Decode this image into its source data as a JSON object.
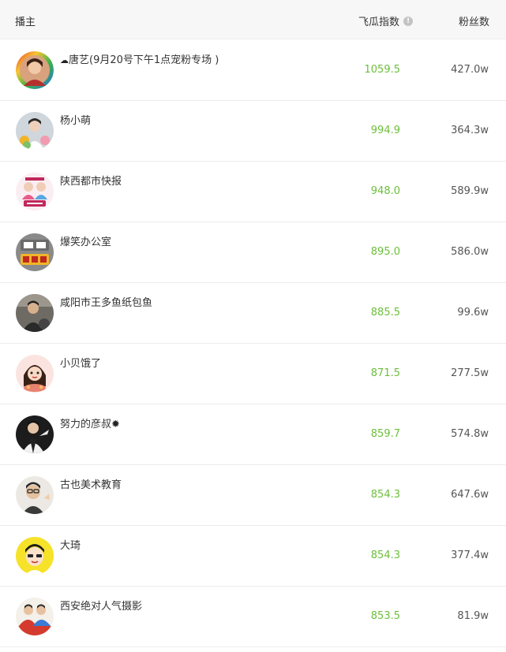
{
  "header": {
    "streamer_label": "播主",
    "index_label": "飞瓜指数",
    "fans_label": "粉丝数",
    "info_icon": "info-icon"
  },
  "rows": [
    {
      "name": "唐艺(9月20号下午1点宠粉专场 )",
      "index": "1059.5",
      "fans": "427.0w",
      "avatar": "avatar-woman-rainbow-ring"
    },
    {
      "name": "杨小萌",
      "index": "994.9",
      "fans": "364.3w",
      "avatar": "avatar-woman-flowers"
    },
    {
      "name": "陕西都市快报",
      "index": "948.0",
      "fans": "589.9w",
      "avatar": "avatar-news-logo"
    },
    {
      "name": "爆笑办公室",
      "index": "895.0",
      "fans": "586.0w",
      "avatar": "avatar-text-logo"
    },
    {
      "name": "咸阳市王多鱼纸包鱼",
      "index": "885.5",
      "fans": "99.6w",
      "avatar": "avatar-man-photo"
    },
    {
      "name": "小贝饿了",
      "index": "871.5",
      "fans": "277.5w",
      "avatar": "avatar-cartoon-girl"
    },
    {
      "name": "努力的彦叔",
      "index": "859.7",
      "fans": "574.8w",
      "avatar": "avatar-man-suit"
    },
    {
      "name": "古也美术教育",
      "index": "854.3",
      "fans": "647.6w",
      "avatar": "avatar-man-glasses"
    },
    {
      "name": "大琦",
      "index": "854.3",
      "fans": "377.4w",
      "avatar": "avatar-cartoon-boy-yellow"
    },
    {
      "name": "西安绝对人气摄影",
      "index": "853.5",
      "fans": "81.9w",
      "avatar": "avatar-two-people"
    }
  ],
  "colors": {
    "index_green": "#6bbf3a",
    "header_bg": "#f7f7f7",
    "divider": "#ececec"
  }
}
